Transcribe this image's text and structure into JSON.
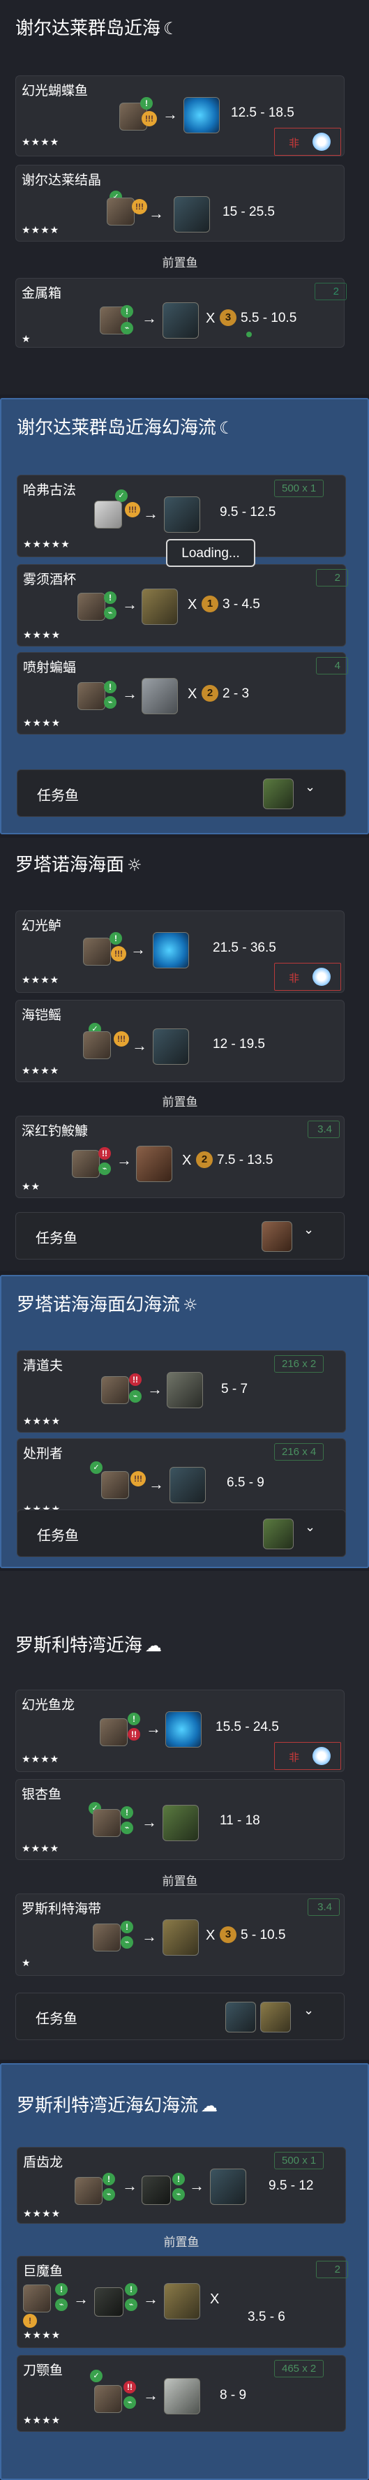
{
  "sections": [
    {
      "title": "谢尔达莱群岛近海",
      "weather_icon": "☾",
      "fish": [
        {
          "name": "幻光蝴蝶鱼",
          "stars": "★★★★",
          "tugs": [
            "!",
            "!!!"
          ],
          "range": "12.5 - 18.5",
          "badge": "非"
        },
        {
          "name": "谢尔达莱结晶",
          "stars": "★★★★",
          "tugs": [
            "!!!"
          ],
          "range": "15 - 25.5"
        }
      ],
      "prev_label": "前置鱼",
      "prev": {
        "name": "金属箱",
        "stars": "★",
        "tag": "2",
        "mooch_n": "3",
        "range": "5.5 - 10.5"
      }
    },
    {
      "title": "谢尔达莱群岛近海幻海流",
      "weather_icon": "☾",
      "fish": [
        {
          "name": "哈弗古法",
          "stars": "★★★★★",
          "tugs": [
            "!!!"
          ],
          "range": "9.5 - 12.5",
          "tag": "500 x 1"
        },
        {
          "name": "雾须酒杯",
          "stars": "★★★★",
          "tugs": [
            "!"
          ],
          "x": "X",
          "n": "1",
          "range": "3 - 4.5",
          "tag": "2"
        },
        {
          "name": "喷射蝙蝠",
          "stars": "★★★★",
          "tugs": [
            "!"
          ],
          "x": "X",
          "n": "2",
          "range": "2 - 3",
          "tag": "4"
        }
      ],
      "loading": "Loading...",
      "task_label": "任务鱼"
    },
    {
      "title": "罗塔诺海海面",
      "weather_icon": "☼",
      "fish": [
        {
          "name": "幻光鲈",
          "stars": "★★★★",
          "tugs": [
            "!",
            "!!!"
          ],
          "range": "21.5 - 36.5",
          "badge": "非"
        },
        {
          "name": "海铠鳐",
          "stars": "★★★★",
          "tugs": [
            "!!!"
          ],
          "range": "12 - 19.5"
        }
      ],
      "prev_label": "前置鱼",
      "prev": {
        "name": "深红钓鮟鱇",
        "stars": "★★",
        "tag": "3.4",
        "mooch_n": "2",
        "range": "7.5 - 13.5"
      },
      "task_label": "任务鱼"
    },
    {
      "title": "罗塔诺海海面幻海流",
      "weather_icon": "☼",
      "fish": [
        {
          "name": "清道夫",
          "stars": "★★★★",
          "tugs": [
            "!!"
          ],
          "range": "5 - 7",
          "tag": "216 x 2"
        },
        {
          "name": "处刑者",
          "stars": "★★★★",
          "tugs": [
            "!!!"
          ],
          "range": "6.5 - 9",
          "tag": "216 x 4"
        }
      ],
      "task_label": "任务鱼"
    },
    {
      "title": "罗斯利特湾近海",
      "weather_icon": "☁",
      "fish": [
        {
          "name": "幻光鱼龙",
          "stars": "★★★★",
          "tugs": [
            "!",
            "!!"
          ],
          "range": "15.5 - 24.5",
          "badge": "非"
        },
        {
          "name": "银杏鱼",
          "stars": "★★★★",
          "tugs": [
            "!"
          ],
          "range": "11 - 18"
        }
      ],
      "prev_label": "前置鱼",
      "prev": {
        "name": "罗斯利特海带",
        "stars": "★",
        "tag": "3.4",
        "mooch_n": "3",
        "range": "5 - 10.5"
      },
      "task_label": "任务鱼"
    },
    {
      "title": "罗斯利特湾近海幻海流",
      "weather_icon": "☁",
      "fish": [
        {
          "name": "盾齿龙",
          "stars": "★★★★",
          "tugs": [
            "!"
          ],
          "range": "9.5 - 12",
          "tag": "500 x 1"
        }
      ],
      "prev_label": "前置鱼",
      "prev": {
        "name": "巨魔鱼",
        "stars": "★★★★",
        "tag": "2",
        "x": "X",
        "range": "3.5 - 6"
      },
      "last": {
        "name": "刀颚鱼",
        "stars": "★★★★",
        "tugs": [
          "!!"
        ],
        "range": "8 - 9",
        "tag": "465 x 2"
      }
    }
  ],
  "arrow": "→",
  "chevron": "⌄"
}
